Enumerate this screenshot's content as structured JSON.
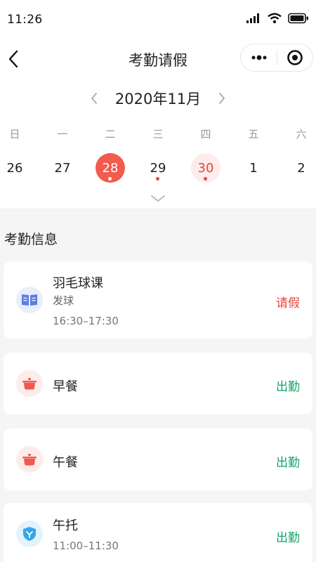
{
  "status_bar": {
    "time": "11:26"
  },
  "nav": {
    "title": "考勤请假"
  },
  "calendar": {
    "month_label": "2020年11月",
    "weekdays": [
      "日",
      "一",
      "二",
      "三",
      "四",
      "五",
      "六"
    ],
    "days": [
      {
        "label": "26",
        "state": "normal",
        "dot": false
      },
      {
        "label": "27",
        "state": "normal",
        "dot": false
      },
      {
        "label": "28",
        "state": "selected",
        "dot": true
      },
      {
        "label": "29",
        "state": "normal",
        "dot": true
      },
      {
        "label": "30",
        "state": "highlight",
        "dot": true
      },
      {
        "label": "1",
        "state": "normal",
        "dot": false
      },
      {
        "label": "2",
        "state": "normal",
        "dot": false
      }
    ]
  },
  "attendance": {
    "section_title": "考勤信息",
    "items": [
      {
        "name": "羽毛球课",
        "sub": "发球",
        "time": "16:30–17:30",
        "status": "请假",
        "icon": "book-icon"
      },
      {
        "name": "早餐",
        "status": "出勤",
        "icon": "pot-icon"
      },
      {
        "name": "午餐",
        "status": "出勤",
        "icon": "pot-icon"
      },
      {
        "name": "午托",
        "time": "11:00–11:30",
        "status": "出勤",
        "icon": "shield-icon"
      }
    ]
  },
  "colors": {
    "accent_red": "#e8453c",
    "selected_day": "#f25b4e",
    "present_green": "#15a368",
    "leave_red": "#e8453c"
  }
}
